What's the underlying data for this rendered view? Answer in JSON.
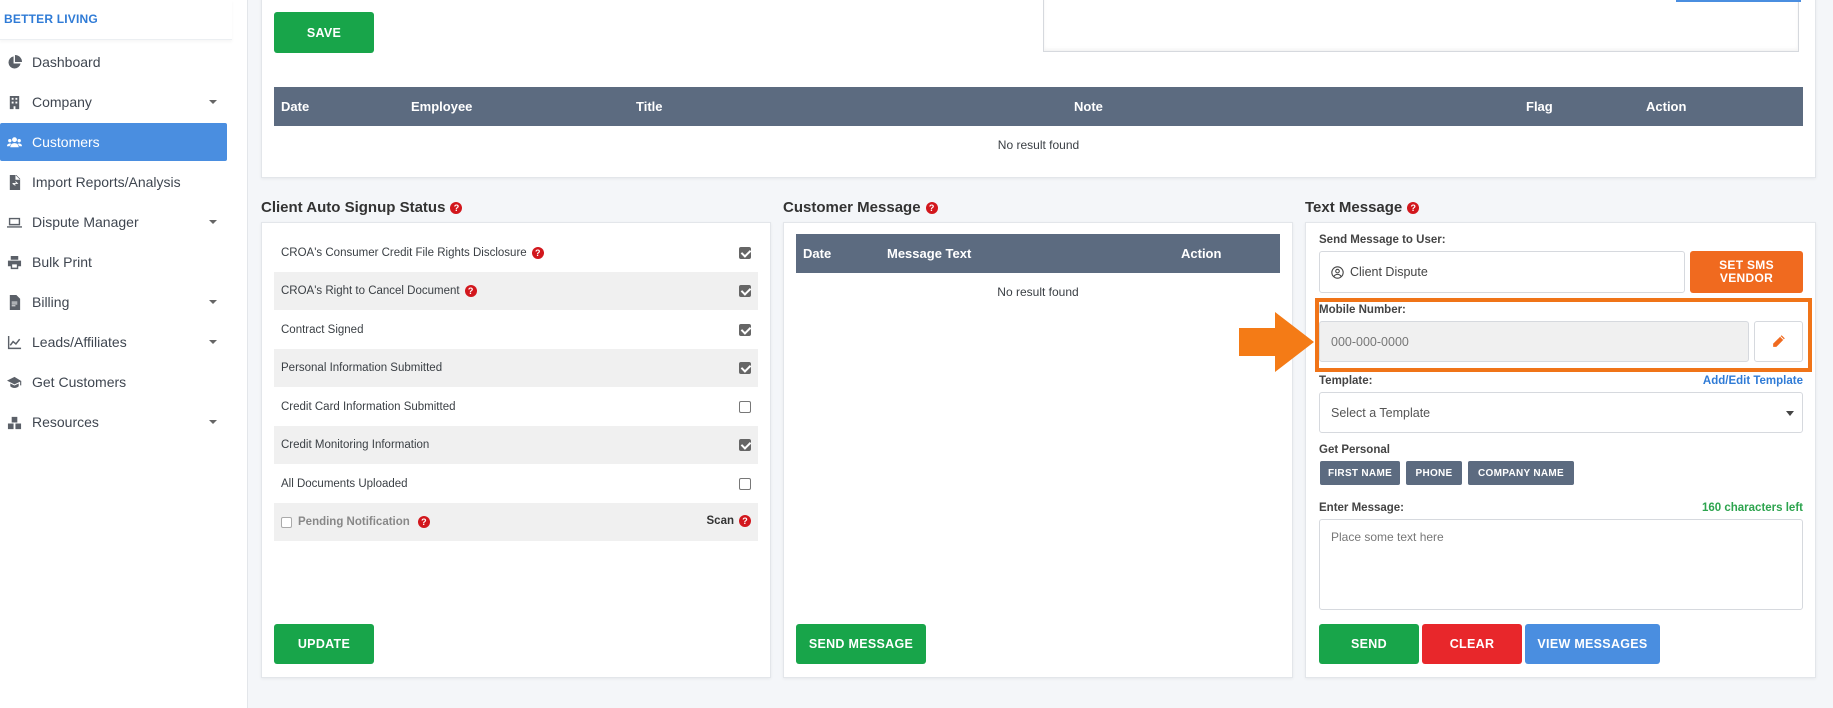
{
  "brand": "BETTER LIVING",
  "sidebar": {
    "items": [
      {
        "label": "Dashboard",
        "icon": "pie-chart-icon"
      },
      {
        "label": "Company",
        "icon": "building-icon"
      },
      {
        "label": "Customers",
        "icon": "users-icon",
        "active": true
      },
      {
        "label": "Import Reports/Analysis",
        "icon": "file-import-icon"
      },
      {
        "label": "Dispute Manager",
        "icon": "laptop-icon"
      },
      {
        "label": "Bulk Print",
        "icon": "printer-icon"
      },
      {
        "label": "Billing",
        "icon": "invoice-icon"
      },
      {
        "label": "Leads/Affiliates",
        "icon": "chart-line-icon"
      },
      {
        "label": "Get Customers",
        "icon": "graduation-cap-icon"
      },
      {
        "label": "Resources",
        "icon": "boxes-icon"
      }
    ]
  },
  "notes": {
    "save_label": "SAVE",
    "columns": [
      "Date",
      "Employee",
      "Title",
      "Note",
      "Flag",
      "Action"
    ],
    "empty": "No result found"
  },
  "signup": {
    "title": "Client Auto Signup Status",
    "rows": [
      {
        "label": "CROA's Consumer Credit File Rights Disclosure",
        "help": true,
        "checked": true
      },
      {
        "label": "CROA's Right to Cancel Document",
        "help": true,
        "checked": true
      },
      {
        "label": "Contract Signed",
        "checked": true
      },
      {
        "label": "Personal Information Submitted",
        "checked": true
      },
      {
        "label": "Credit Card Information Submitted",
        "checked": false
      },
      {
        "label": "Credit Monitoring Information",
        "checked": true
      },
      {
        "label": "All Documents Uploaded",
        "checked": false
      }
    ],
    "pending_label": "Pending Notification",
    "scan_label": "Scan",
    "update_label": "UPDATE"
  },
  "customer_message": {
    "title": "Customer Message",
    "columns": [
      "Date",
      "Message Text",
      "Action"
    ],
    "empty": "No result found",
    "send_label": "SEND MESSAGE"
  },
  "text_message": {
    "title": "Text Message",
    "send_to_label": "Send Message to User:",
    "send_to_value": "Client Dispute",
    "sms_vendor_label": "SET SMS VENDOR",
    "mobile_label": "Mobile Number:",
    "mobile_placeholder": "000-000-0000",
    "template_label": "Template:",
    "template_link": "Add/Edit Template",
    "template_value": "Select a Template",
    "personal_label": "Get Personal",
    "chips": [
      "FIRST NAME",
      "PHONE",
      "COMPANY NAME"
    ],
    "enter_label": "Enter Message:",
    "chars_left": "160 characters left",
    "message_placeholder": "Place some text here",
    "send_label": "SEND",
    "clear_label": "CLEAR",
    "view_label": "VIEW MESSAGES"
  },
  "colors": {
    "accent_blue": "#4a8ee0",
    "green": "#18a54a",
    "red": "#e8272b",
    "orange_highlight": "#f07418",
    "table_header": "#5c6b80"
  }
}
